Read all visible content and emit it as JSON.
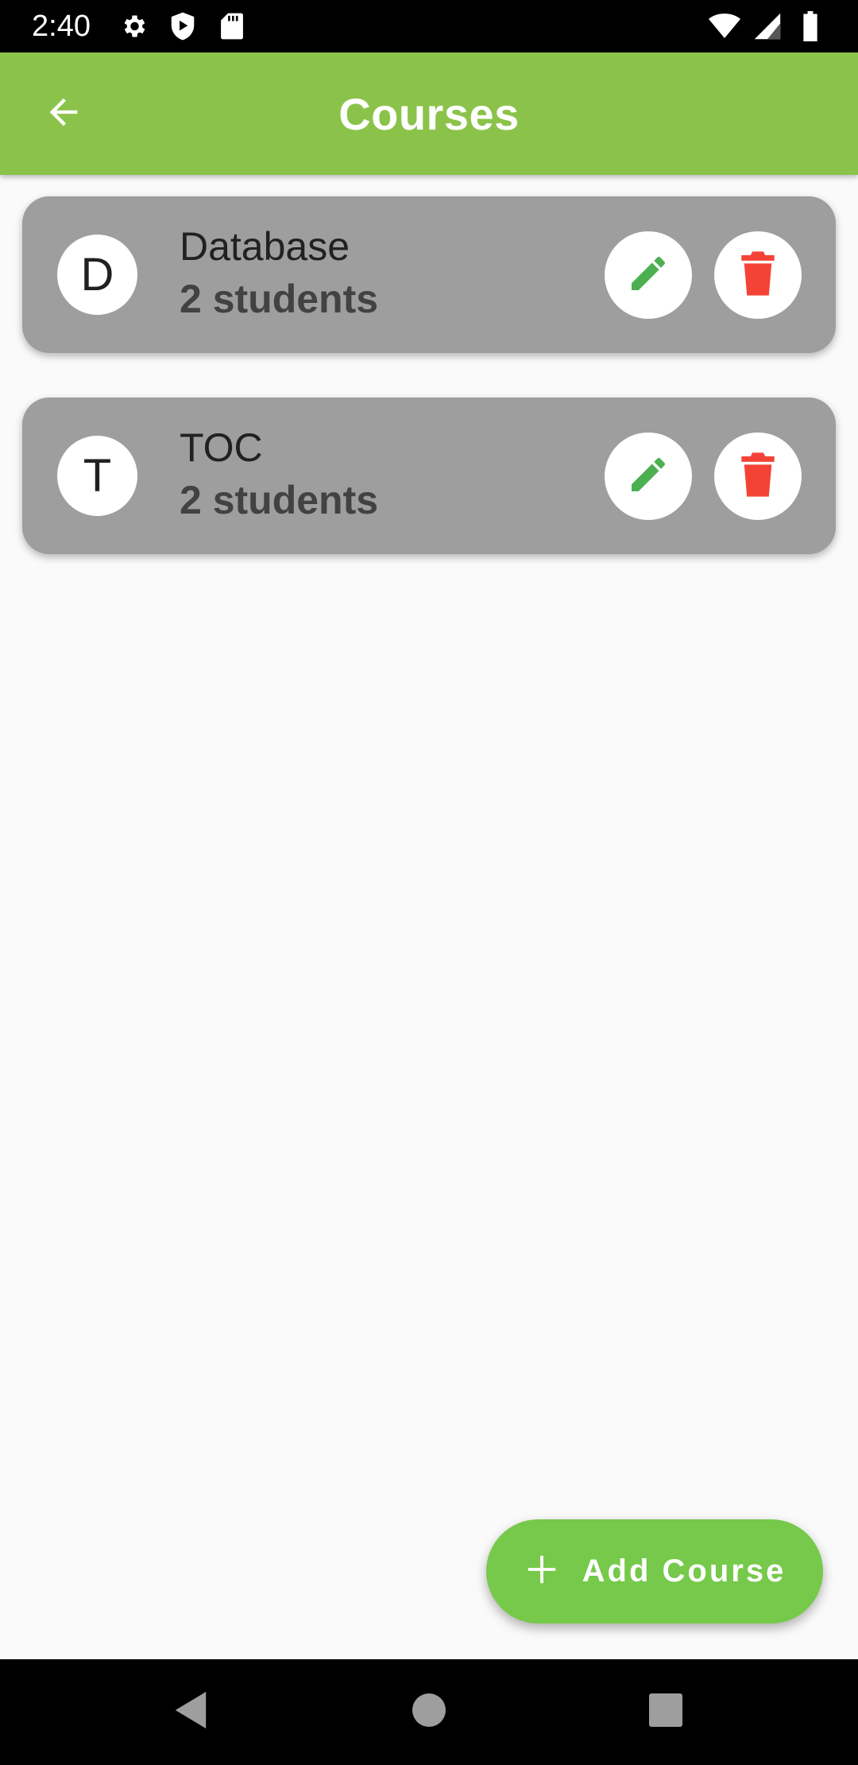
{
  "status_bar": {
    "time": "2:40",
    "left_icons": [
      "gear-icon",
      "shield-play-icon",
      "sd-card-icon"
    ],
    "right_icons": [
      "wifi-icon",
      "cell-signal-icon",
      "battery-icon"
    ]
  },
  "app_bar": {
    "title": "Courses",
    "back_icon": "arrow-left-icon",
    "color": "#8bc34a"
  },
  "courses": [
    {
      "initial": "D",
      "name": "Database",
      "students": "2 students"
    },
    {
      "initial": "T",
      "name": "TOC",
      "students": "2 students"
    }
  ],
  "card_actions": {
    "edit_icon": "pencil-icon",
    "edit_color": "#4caf50",
    "delete_icon": "trash-icon",
    "delete_color": "#f44336"
  },
  "fab": {
    "label": "Add Course",
    "icon": "plus-icon",
    "color": "#76c94a"
  },
  "nav_bar": {
    "buttons": [
      "back-triangle-icon",
      "home-circle-icon",
      "recents-square-icon"
    ]
  }
}
